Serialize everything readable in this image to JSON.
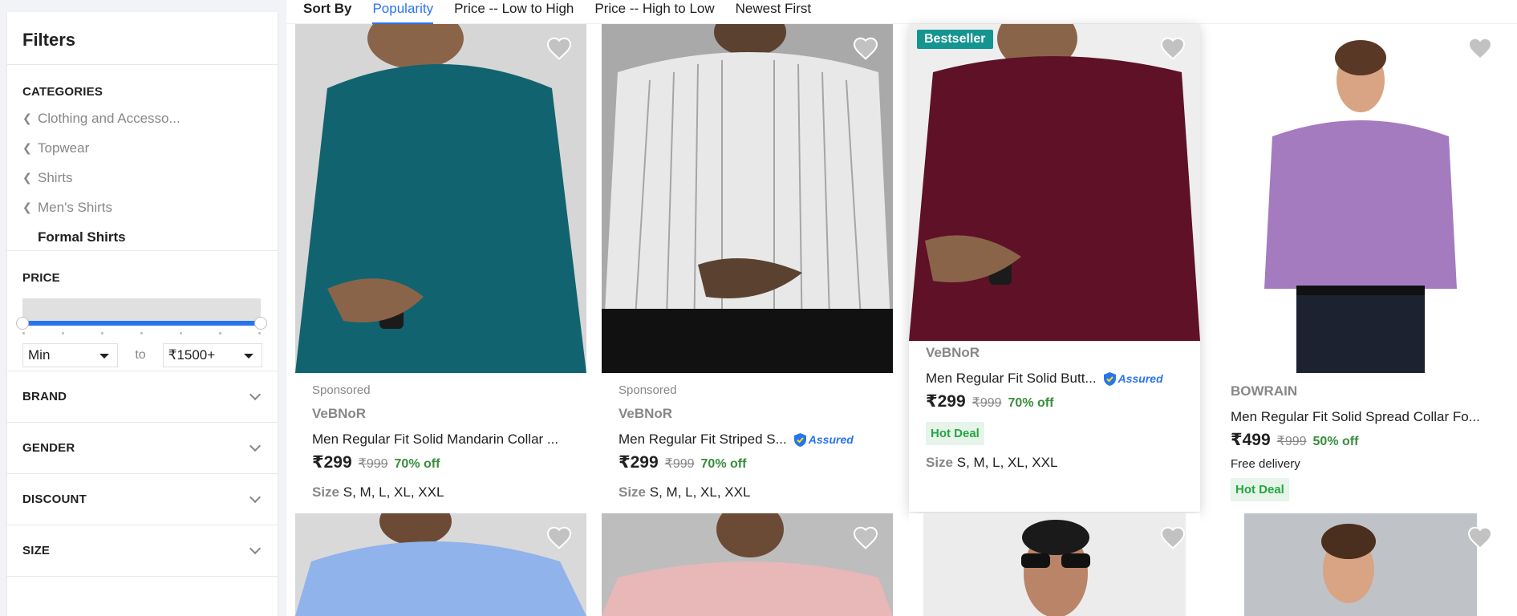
{
  "sidebar": {
    "title": "Filters",
    "categories_heading": "CATEGORIES",
    "categories": [
      {
        "label": "Clothing and Accesso..."
      },
      {
        "label": "Topwear"
      },
      {
        "label": "Shirts"
      },
      {
        "label": "Men's Shirts"
      }
    ],
    "current_category": "Formal Shirts",
    "price_heading": "PRICE",
    "price_min": "Min",
    "price_to": "to",
    "price_max": "₹1500+",
    "collapsibles": [
      "BRAND",
      "GENDER",
      "DISCOUNT",
      "SIZE"
    ]
  },
  "sort": {
    "label": "Sort By",
    "options": [
      "Popularity",
      "Price -- Low to High",
      "Price -- High to Low",
      "Newest First"
    ],
    "active": "Popularity"
  },
  "products": [
    {
      "sponsored": "Sponsored",
      "brand": "VeBNoR",
      "title": "Men Regular Fit Solid Mandarin Collar ...",
      "assured": false,
      "price": "₹299",
      "mrp": "₹999",
      "off": "70% off",
      "size_label": "Size",
      "sizes": "S, M, L, XL, XXL",
      "shirt_color": "#11636f"
    },
    {
      "sponsored": "Sponsored",
      "brand": "VeBNoR",
      "title": "Men Regular Fit Striped S...",
      "assured": true,
      "assured_label": "Assured",
      "price": "₹299",
      "mrp": "₹999",
      "off": "70% off",
      "size_label": "Size",
      "sizes": "S, M, L, XL, XXL",
      "shirt_color": "#e8e8e8"
    },
    {
      "badge": "Bestseller",
      "brand": "VeBNoR",
      "title": "Men Regular Fit Solid Butt...",
      "assured": true,
      "assured_label": "Assured",
      "price": "₹299",
      "mrp": "₹999",
      "off": "70% off",
      "deal": "Hot Deal",
      "size_label": "Size",
      "sizes": "S, M, L, XL, XXL",
      "shirt_color": "#5e1127"
    },
    {
      "brand": "BOWRAIN",
      "title": "Men Regular Fit Solid Spread Collar Fo...",
      "price": "₹499",
      "mrp": "₹999",
      "off": "50% off",
      "delivery": "Free delivery",
      "deal": "Hot Deal",
      "shirt_color": "#a57bc0"
    }
  ],
  "row2_colors": [
    "#8fb3ea",
    "#e8b7b7",
    "#ececec",
    "#bfc3c8"
  ],
  "icons": {
    "wishlist": "heart-icon",
    "chevron": "chevron-left-icon",
    "expand": "chevron-down-icon",
    "assured": "shield-check-icon"
  },
  "colors": {
    "accent": "#2874f0",
    "green": "#388e3c",
    "bestseller": "#14958f"
  }
}
